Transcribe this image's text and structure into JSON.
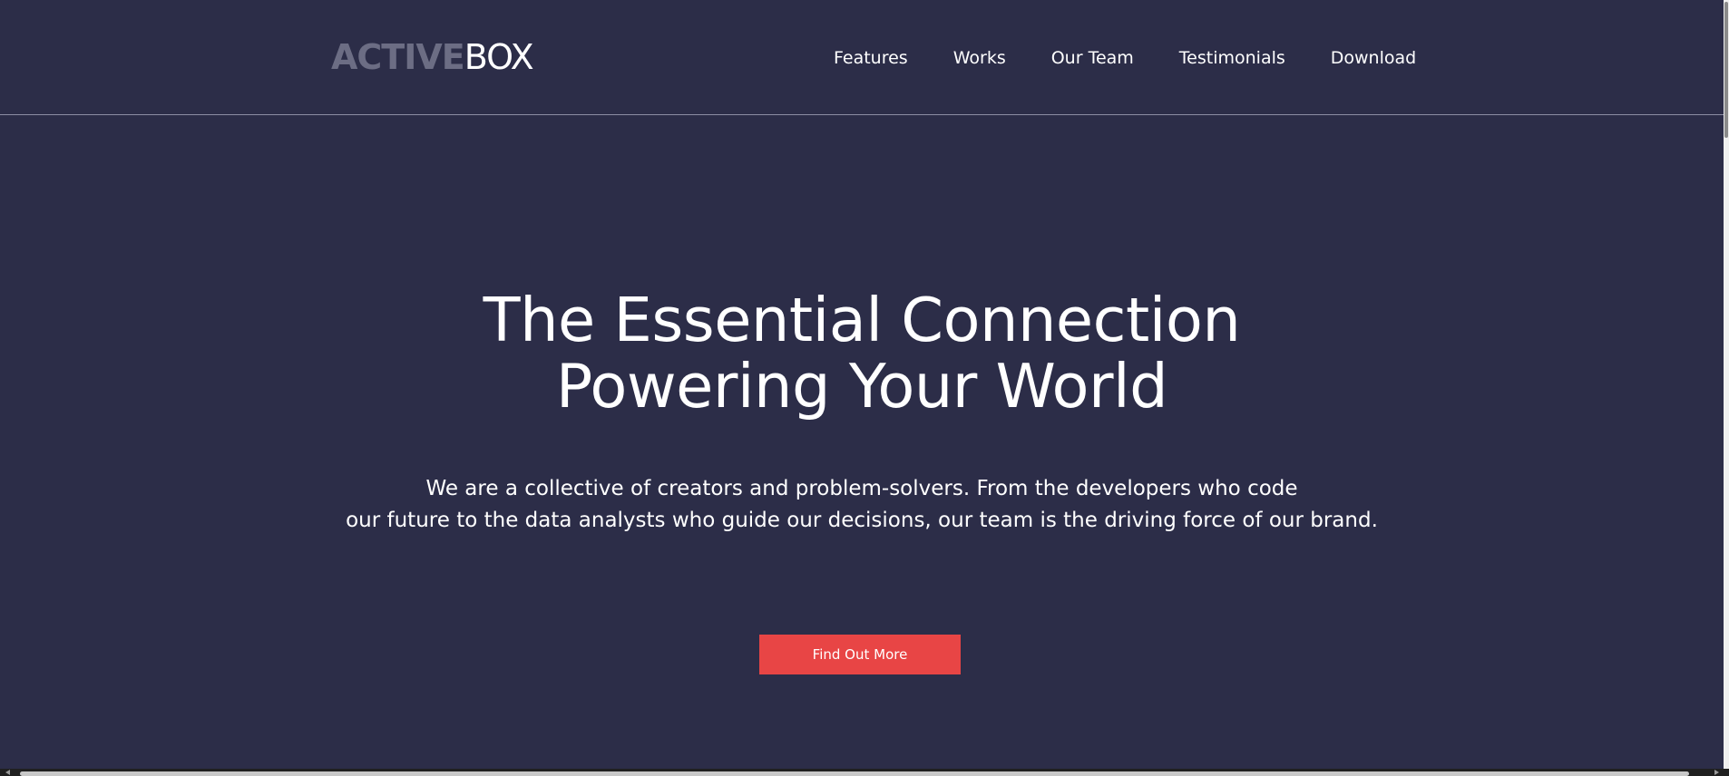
{
  "brand": {
    "logo_part1": "ACTIVE",
    "logo_part2": "BOX"
  },
  "nav": {
    "items": [
      {
        "label": "Features"
      },
      {
        "label": "Works"
      },
      {
        "label": "Our Team"
      },
      {
        "label": "Testimonials"
      },
      {
        "label": "Download"
      }
    ]
  },
  "hero": {
    "title_line1": "The Essential Connection",
    "title_line2": "Powering Your World",
    "subtitle_line1": "We are a collective of creators and problem-solvers. From the developers who code",
    "subtitle_line2": "our future to the data analysts who guide our decisions, our team is the driving force of our brand.",
    "cta_label": "Find Out More"
  },
  "colors": {
    "background": "#2c2d48",
    "accent": "#e84545",
    "logo_muted": "#6c6d84",
    "divider": "#8c8da3"
  }
}
